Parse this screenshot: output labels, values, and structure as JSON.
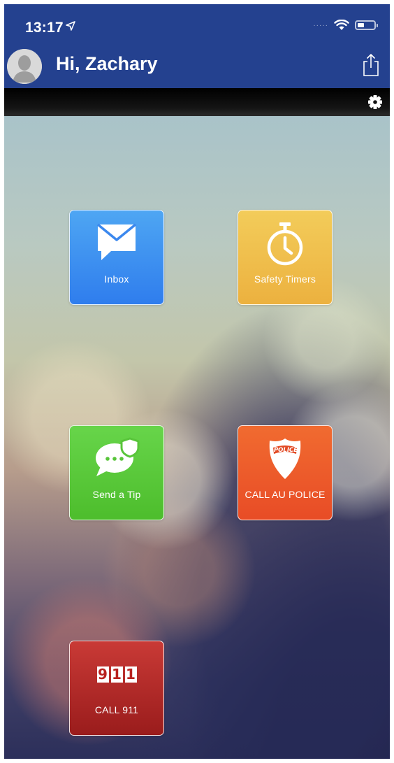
{
  "status_bar": {
    "time": "13:17",
    "location_icon": "location-arrow-icon",
    "signal": "·····",
    "wifi_icon": "wifi-icon",
    "battery_icon": "battery-icon"
  },
  "header": {
    "greeting": "Hi, Zachary",
    "avatar_icon": "user-avatar-icon",
    "share_icon": "share-icon",
    "background_color": "#24418f"
  },
  "toolbar": {
    "settings_icon": "gear-icon"
  },
  "tiles": [
    {
      "label": "Inbox",
      "icon": "envelope-icon",
      "color": "#3a8ff0"
    },
    {
      "label": "Safety Timers",
      "icon": "stopwatch-icon",
      "color": "#efbf4a"
    },
    {
      "label": "Send a Tip",
      "icon": "chat-bubble-shield-icon",
      "color": "#5acb3a"
    },
    {
      "label": "CALL AU POLICE",
      "icon": "police-badge-icon",
      "badge_text": "POLICE",
      "color": "#ec5a2a"
    },
    {
      "label": "CALL 911",
      "icon": "911-icon",
      "digits": [
        "9",
        "1",
        "1"
      ],
      "color": "#b52b28"
    }
  ]
}
